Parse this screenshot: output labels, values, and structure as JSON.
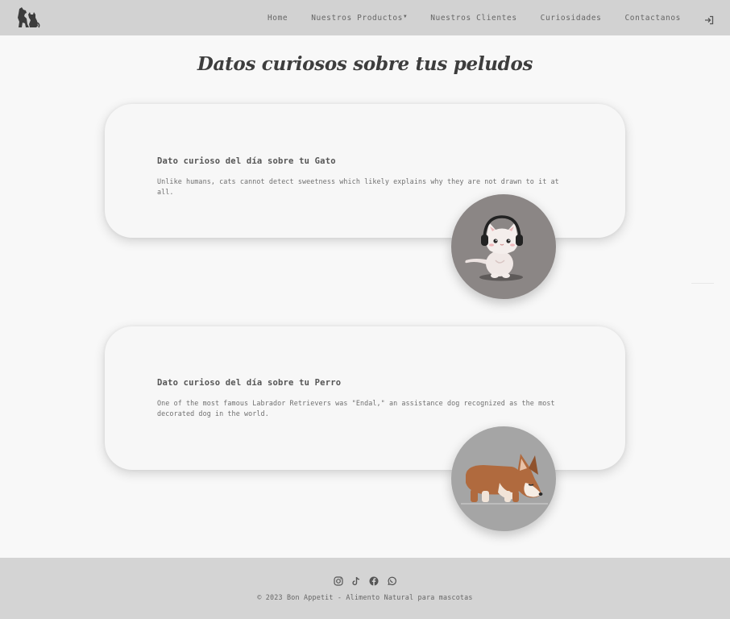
{
  "navbar": {
    "brand_icon": "dog-cat-logo-icon",
    "links": {
      "home": "Home",
      "products": "Nuestros Productos",
      "clients": "Nuestros Clientes",
      "curiosities": "Curiosidades",
      "contact": "Contactanos"
    },
    "login_icon": "login-icon"
  },
  "page": {
    "title": "Datos curiosos sobre tus peludos"
  },
  "cards": [
    {
      "title": "Dato curioso del día sobre tu Gato",
      "text": "Unlike humans, cats cannot detect sweetness which likely explains why they are not drawn to it at all.",
      "image": "cat-with-headphones-illustration"
    },
    {
      "title": "Dato curioso del día sobre tu Perro",
      "text": "One of the most famous Labrador Retrievers was \"Endal,\" an assistance dog recognized as the most decorated dog in the world.",
      "image": "corgi-dog-illustration"
    }
  ],
  "footer": {
    "social": [
      "instagram-icon",
      "tiktok-icon",
      "facebook-icon",
      "whatsapp-icon"
    ],
    "copyright": "© 2023 Bon Appetit - Alimento Natural para mascotas"
  },
  "colors": {
    "navbar_bg": "#d2d2d2",
    "page_bg": "#f8f8f8",
    "card_bg": "#f7f7f7",
    "cat_circle_bg": "#8b8685",
    "dog_circle_bg": "#a5a5a5",
    "footer_bg": "#d4d4d4"
  }
}
